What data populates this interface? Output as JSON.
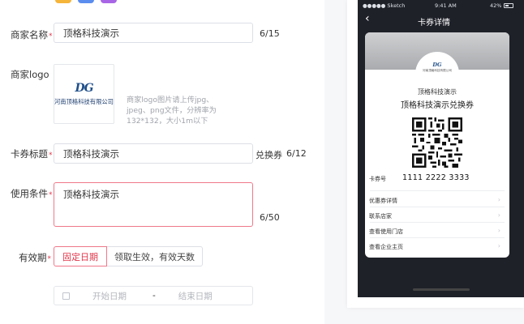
{
  "theme": {
    "accent": "#e0364a",
    "accent_border": "#f0788a",
    "swatch_colors": [
      "#f5b43a",
      "#5b8def",
      "#a866e6"
    ]
  },
  "form": {
    "merchant_name": {
      "label": "商家名称",
      "required_mark": "*",
      "value": "顶格科技演示",
      "counter": "6/15"
    },
    "merchant_logo": {
      "label": "商家logo",
      "logo_mark": "DG",
      "logo_company": "河南顶格科技有限公司",
      "hint": "商家logo图片请上传jpg、jpeg、png文件，分辨率为132*132，大小1m以下"
    },
    "coupon_title": {
      "label": "卡券标题",
      "required_mark": "*",
      "value": "顶格科技演示",
      "suffix": "兑换券",
      "counter": "6/12"
    },
    "usage_terms": {
      "label": "使用条件",
      "required_mark": "*",
      "value": "顶格科技演示",
      "counter": "6/50"
    },
    "validity": {
      "label": "有效期",
      "required_mark": "*",
      "options": [
        "固定日期",
        "领取生效，有效天数"
      ],
      "selected": "固定日期"
    },
    "date_range": {
      "start_placeholder": "开始日期",
      "separator": "-",
      "end_placeholder": "结束日期"
    }
  },
  "preview": {
    "status": {
      "carrier": "●●●●● Sketch",
      "time": "9:41 AM",
      "battery_pct": "42%"
    },
    "nav": {
      "back": "‹",
      "title": "卡券详情"
    },
    "card": {
      "badge_mark": "DG",
      "badge_company": "河南顶格科技有限公司",
      "merchant": "顶格科技演示",
      "title": "顶格科技演示兑换券",
      "code_label": "卡券号",
      "code_value": "1111 2222 3333",
      "menu": [
        "优惠券详情",
        "联系店家",
        "查看使用门店",
        "查看企业主页"
      ]
    }
  }
}
